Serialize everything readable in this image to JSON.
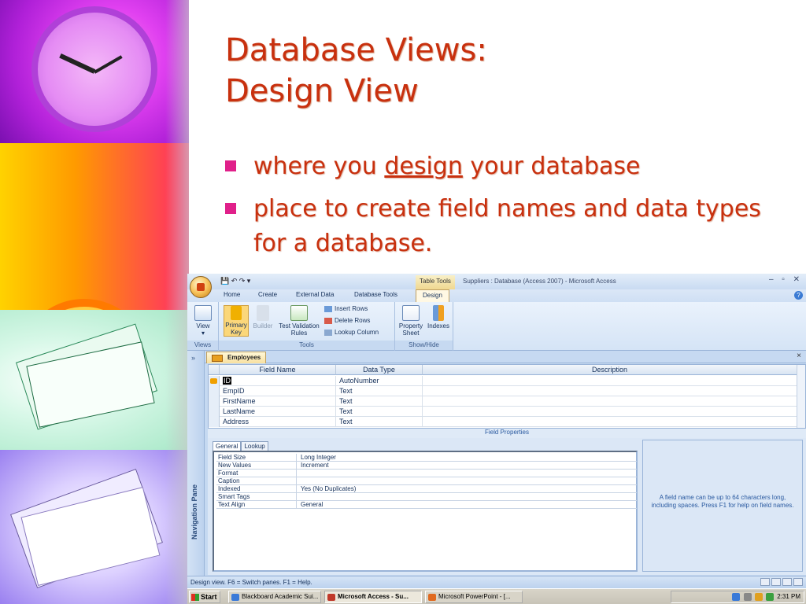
{
  "slide": {
    "title_line1": "Database Views:",
    "title_line2": "Design View",
    "bullets": [
      {
        "before": "where you ",
        "emph": "design",
        "after": " your database"
      },
      {
        "text": "place to create field names and data types for a database."
      }
    ],
    "colors": {
      "title": "#c8300e",
      "bullet_marker": "#e0208a"
    }
  },
  "access": {
    "window_title": "Suppliers : Database (Access 2007) - Microsoft Access",
    "context_tab": "Table Tools",
    "ribbon_tabs": [
      "Home",
      "Create",
      "External Data",
      "Database Tools",
      "Design"
    ],
    "ribbon": {
      "view_label": "View",
      "views_group": "Views",
      "primary_key_label": "Primary Key",
      "builder_label": "Builder",
      "test_validation_label": "Test Validation Rules",
      "insert_rows": "Insert Rows",
      "delete_rows": "Delete Rows",
      "lookup_column": "Lookup Column",
      "tools_group": "Tools",
      "property_sheet": "Property Sheet",
      "indexes": "Indexes",
      "showhide_group": "Show/Hide"
    },
    "nav_pane_label": "Navigation Pane",
    "nav_toggle": "»",
    "doc_tab": "Employees",
    "doc_close": "×",
    "grid": {
      "headers": {
        "field_name": "Field Name",
        "data_type": "Data Type",
        "description": "Description"
      },
      "rows": [
        {
          "field": "ID",
          "type": "AutoNumber"
        },
        {
          "field": "EmpID",
          "type": "Text"
        },
        {
          "field": "FirstName",
          "type": "Text"
        },
        {
          "field": "LastName",
          "type": "Text"
        },
        {
          "field": "Address",
          "type": "Text"
        }
      ]
    },
    "field_properties_label": "Field Properties",
    "fp_tabs": {
      "general": "General",
      "lookup": "Lookup"
    },
    "properties": [
      {
        "name": "Field Size",
        "value": "Long Integer"
      },
      {
        "name": "New Values",
        "value": "Increment"
      },
      {
        "name": "Format",
        "value": ""
      },
      {
        "name": "Caption",
        "value": ""
      },
      {
        "name": "Indexed",
        "value": "Yes (No Duplicates)"
      },
      {
        "name": "Smart Tags",
        "value": ""
      },
      {
        "name": "Text Align",
        "value": "General"
      }
    ],
    "help_text": "A field name can be up to 64 characters long, including spaces.  Press F1 for help on field names.",
    "status_text": "Design view.  F6 = Switch panes.  F1 = Help."
  },
  "taskbar": {
    "start": "Start",
    "tasks": [
      "Blackboard Academic Sui...",
      "Microsoft Access - Su...",
      "Microsoft PowerPoint - [..."
    ],
    "clock": "2:31 PM"
  }
}
